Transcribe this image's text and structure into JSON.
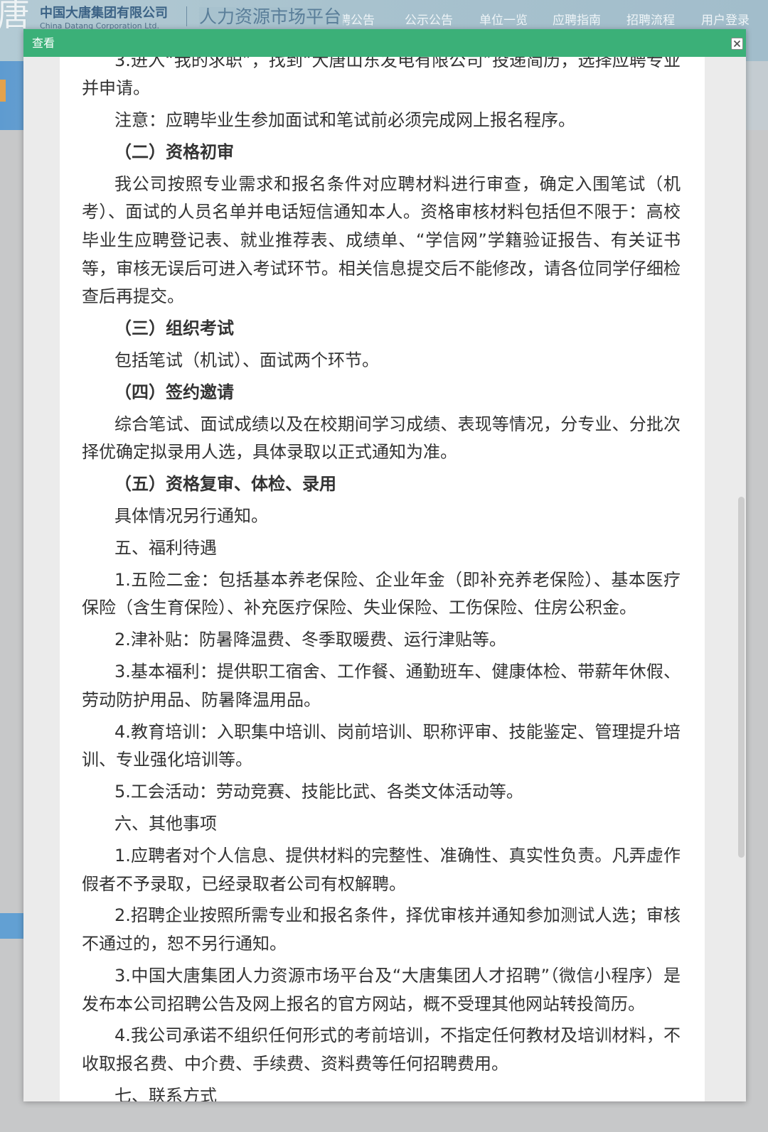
{
  "background_page": {
    "logo": {
      "emblem": "唐",
      "name_cn": "中国大唐集团有限公司",
      "name_en": "China Datang Corporation Ltd."
    },
    "platform_title": "人力资源市场平台",
    "nav": [
      {
        "label": "招聘公告"
      },
      {
        "label": "公示公告"
      },
      {
        "label": "单位一览"
      },
      {
        "label": "应聘指南"
      },
      {
        "label": "招聘流程"
      },
      {
        "label": "用户登录"
      }
    ]
  },
  "dialog": {
    "title": "查看",
    "close_icon": "close-icon",
    "document": {
      "paragraphs": [
        {
          "heading": false,
          "lines": [
            "3.进入“我的求职”，找到“大唐山东发电有限公司”投递简历，选择应聘专业",
            "并申请。"
          ]
        },
        {
          "heading": false,
          "lines": [
            "注意：应聘毕业生参加面试和笔试前必须完成网上报名程序。"
          ]
        },
        {
          "heading": true,
          "lines": [
            "（二）资格初审"
          ]
        },
        {
          "heading": false,
          "lines": [
            "我公司按照专业需求和报名条件对应聘材料进行审查，确定入围笔试（机",
            "考）、面试的人员名单并电话短信通知本人。资格审核材料包括但不限于：高校",
            "毕业生应聘登记表、就业推荐表、成绩单、“学信网”学籍验证报告、有关证书",
            "等，审核无误后可进入考试环节。相关信息提交后不能修改，请各位同学仔细检",
            "查后再提交。"
          ]
        },
        {
          "heading": true,
          "lines": [
            "（三）组织考试"
          ]
        },
        {
          "heading": false,
          "lines": [
            "包括笔试（机试）、面试两个环节。"
          ]
        },
        {
          "heading": true,
          "lines": [
            "（四）签约邀请"
          ]
        },
        {
          "heading": false,
          "lines": [
            "综合笔试、面试成绩以及在校期间学习成绩、表现等情况，分专业、分批次",
            "择优确定拟录用人选，具体录取以正式通知为准。"
          ]
        },
        {
          "heading": true,
          "lines": [
            "（五）资格复审、体检、录用"
          ]
        },
        {
          "heading": false,
          "lines": [
            "具体情况另行通知。"
          ]
        },
        {
          "heading": false,
          "lines": [
            "五、福利待遇"
          ]
        },
        {
          "heading": false,
          "lines": [
            "1.五险二金：包括基本养老保险、企业年金（即补充养老保险）、基本医疗",
            "保险（含生育保险）、补充医疗保险、失业保险、工伤保险、住房公积金。"
          ]
        },
        {
          "heading": false,
          "lines": [
            "2.津补贴：防暑降温费、冬季取暖费、运行津贴等。"
          ]
        },
        {
          "heading": false,
          "lines": [
            "3.基本福利：提供职工宿舍、工作餐、通勤班车、健康体检、带薪年休假、",
            "劳动防护用品、防暑降温用品。"
          ]
        },
        {
          "heading": false,
          "lines": [
            "4.教育培训：入职集中培训、岗前培训、职称评审、技能鉴定、管理提升培",
            "训、专业强化培训等。"
          ]
        },
        {
          "heading": false,
          "lines": [
            "5.工会活动：劳动竞赛、技能比武、各类文体活动等。"
          ]
        },
        {
          "heading": false,
          "lines": [
            "六、其他事项"
          ]
        },
        {
          "heading": false,
          "lines": [
            "1.应聘者对个人信息、提供材料的完整性、准确性、真实性负责。凡弄虚作",
            "假者不予录取，已经录取者公司有权解聘。"
          ]
        },
        {
          "heading": false,
          "lines": [
            "2.招聘企业按照所需专业和报名条件，择优审核并通知参加测试人选；审核",
            "不通过的，恕不另行通知。"
          ]
        },
        {
          "heading": false,
          "lines": [
            "3.中国大唐集团人力资源市场平台及“大唐集团人才招聘”（微信小程序）是",
            "发布本公司招聘公告及网上报名的官方网站，概不受理其他网站转投简历。"
          ]
        },
        {
          "heading": false,
          "lines": [
            "4.我公司承诺不组织任何形式的考前培训，不指定任何教材及培训材料，不",
            "收取报名费、中介费、手续费、资料费等任何招聘费用。"
          ]
        },
        {
          "heading": false,
          "lines": [
            "七、联系方式"
          ]
        }
      ]
    }
  },
  "colors": {
    "title_bar": "#3bb078",
    "backdrop": "#c7c8c9",
    "dialog_body": "#ebebeb",
    "paper": "#ffffff",
    "text": "#333333"
  }
}
